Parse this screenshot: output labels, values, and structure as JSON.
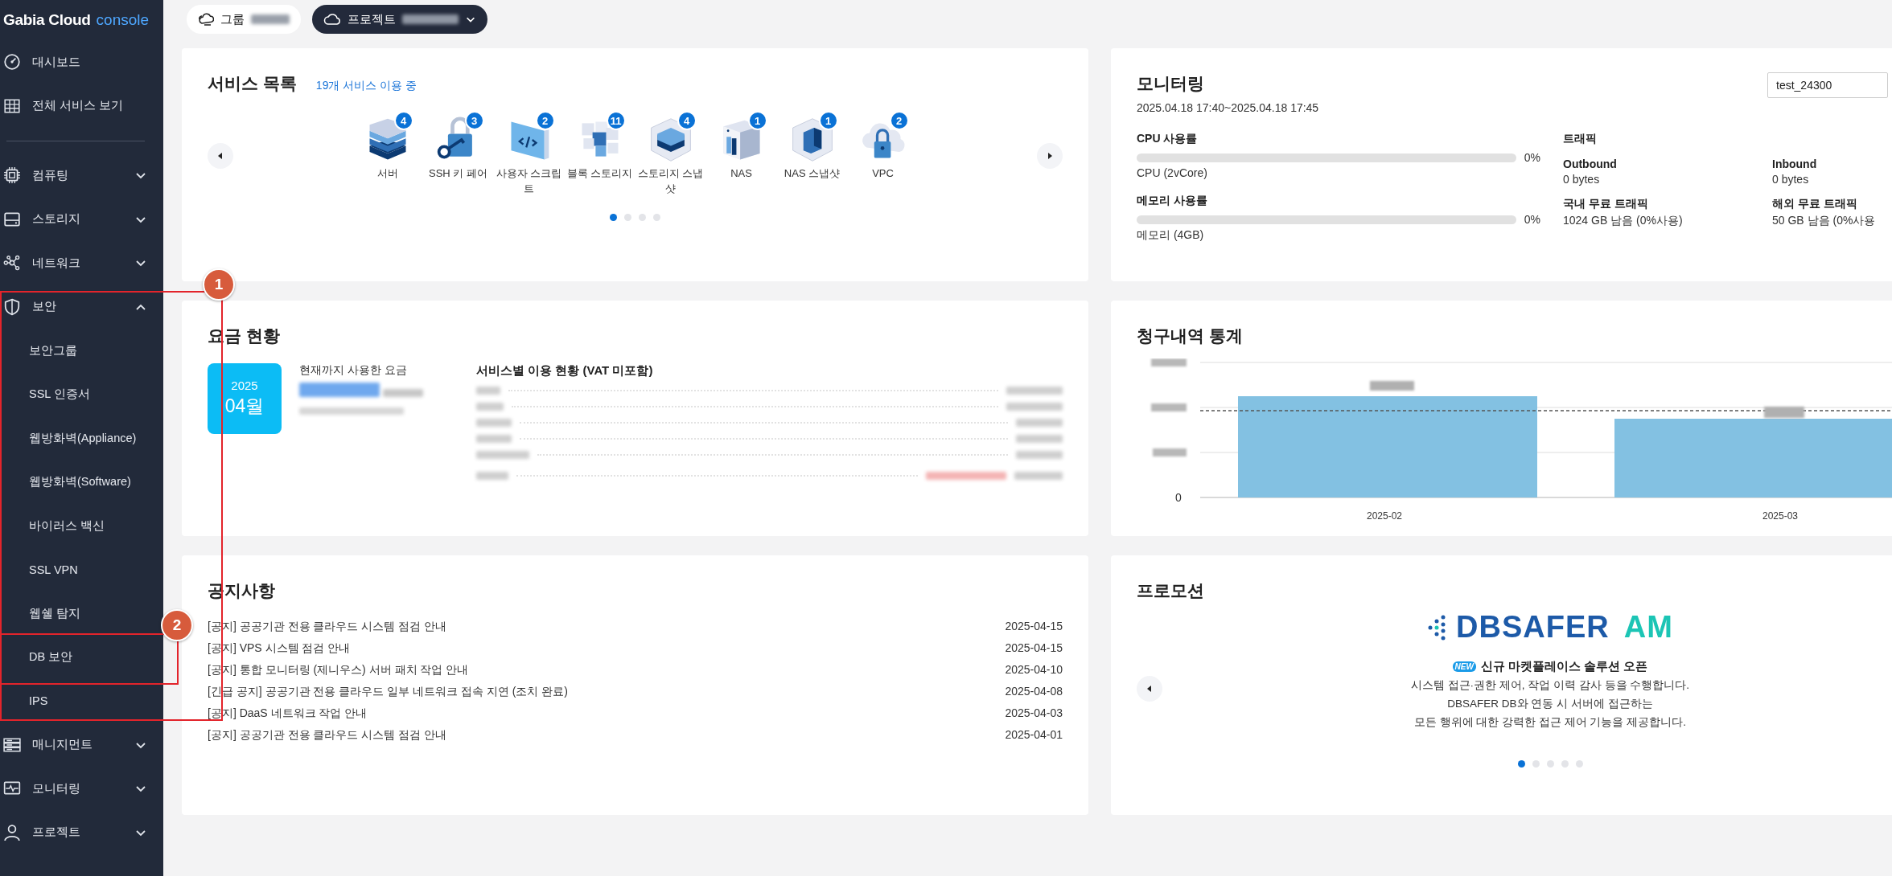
{
  "logo": {
    "brand": "Gabia Cloud",
    "product": "console"
  },
  "topbar": {
    "group_label": "그룹",
    "project_label": "프로젝트"
  },
  "sidebar": {
    "links": [
      {
        "label": "대시보드"
      },
      {
        "label": "전체 서비스 보기"
      }
    ],
    "groups": [
      {
        "label": "컴퓨팅",
        "expanded": false
      },
      {
        "label": "스토리지",
        "expanded": false
      },
      {
        "label": "네트워크",
        "expanded": false
      },
      {
        "label": "보안",
        "expanded": true,
        "children": [
          {
            "label": "보안그룹"
          },
          {
            "label": "SSL 인증서"
          },
          {
            "label": "웹방화벽(Appliance)"
          },
          {
            "label": "웹방화벽(Software)"
          },
          {
            "label": "바이러스 백신"
          },
          {
            "label": "SSL VPN"
          },
          {
            "label": "웹쉘 탐지"
          },
          {
            "label": "DB 보안"
          },
          {
            "label": "IPS"
          }
        ]
      },
      {
        "label": "매니지먼트",
        "expanded": false
      },
      {
        "label": "모니터링",
        "expanded": false
      },
      {
        "label": "프로젝트",
        "expanded": false
      }
    ]
  },
  "annotations": [
    {
      "number": "1"
    },
    {
      "number": "2"
    }
  ],
  "services": {
    "title": "서비스 목록",
    "summary": "19개 서비스 이용 중",
    "items": [
      {
        "label": "서버",
        "count": "4"
      },
      {
        "label": "SSH 키 페어",
        "count": "3"
      },
      {
        "label": "사용자 스크립트",
        "count": "2"
      },
      {
        "label": "블록 스토리지",
        "count": "11"
      },
      {
        "label": "스토리지 스냅샷",
        "count": "4"
      },
      {
        "label": "NAS",
        "count": "1"
      },
      {
        "label": "NAS 스냅샷",
        "count": "1"
      },
      {
        "label": "VPC",
        "count": "2"
      }
    ],
    "dots": [
      {
        "selected": true
      },
      {
        "selected": false
      },
      {
        "selected": false
      },
      {
        "selected": false
      }
    ]
  },
  "monitoring": {
    "title": "모니터링",
    "range": "2025.04.18 17:40~2025.04.18 17:45",
    "server_select": "test_24300",
    "metrics": [
      {
        "label": "CPU 사용률",
        "level": 0,
        "reading": "0%",
        "detail": "CPU (2vCore)"
      },
      {
        "label": "메모리 사용률",
        "level": 0,
        "reading": "0%",
        "detail": "메모리 (4GB)"
      }
    ],
    "traffic": {
      "title": "트래픽",
      "items": [
        {
          "label": "Outbound",
          "value": "0 bytes"
        },
        {
          "label": "Inbound",
          "value": "0 bytes"
        },
        {
          "label": "국내 무료 트래픽",
          "value": "1024 GB 남음 (0%사용)"
        },
        {
          "label": "해외 무료 트래픽",
          "value": "50 GB 남음 (0%사용"
        }
      ]
    }
  },
  "fees": {
    "title": "요금 현황",
    "year": "2025",
    "month": "04월",
    "current_label": "현재까지 사용한 요금",
    "breakdown_title": "서비스별 이용 현황 (VAT 미포함)"
  },
  "billing": {
    "title": "청구내역 통계",
    "y_zero": "0",
    "categories": [
      "2025-02",
      "2025-03"
    ]
  },
  "notices": {
    "title": "공지사항",
    "items": [
      {
        "title": "[공지] 공공기관 전용 클라우드 시스템 점검 안내",
        "date": "2025-04-15"
      },
      {
        "title": "[공지] VPS 시스템 점검 안내",
        "date": "2025-04-15"
      },
      {
        "title": "[공지] 통합 모니터링 (제니우스) 서버 패치 작업 안내",
        "date": "2025-04-10"
      },
      {
        "title": "[긴급 공지] 공공기관 전용 클라우드 일부 네트워크 접속 지연 (조치 완료)",
        "date": "2025-04-08"
      },
      {
        "title": "[공지] DaaS 네트워크 작업 안내",
        "date": "2025-04-03"
      },
      {
        "title": "[공지] 공공기관 전용 클라우드 시스템 점검 안내",
        "date": "2025-04-01"
      }
    ]
  },
  "promotion": {
    "title": "프로모션",
    "logo_main": "DBSAFER",
    "logo_suffix": "AM",
    "badge": "NEW",
    "headline": "신규 마켓플레이스 솔루션 오픈",
    "lines": [
      "시스템 접근·권한 제어, 작업 이력 감사 등을 수행합니다.",
      "DBSAFER DB와 연동 시 서버에 접근하는",
      "모든 행위에 대한 강력한 접근 제어 기능을 제공합니다."
    ],
    "dots": [
      {
        "selected": true
      },
      {
        "selected": false
      },
      {
        "selected": false
      },
      {
        "selected": false
      },
      {
        "selected": false
      }
    ]
  }
}
